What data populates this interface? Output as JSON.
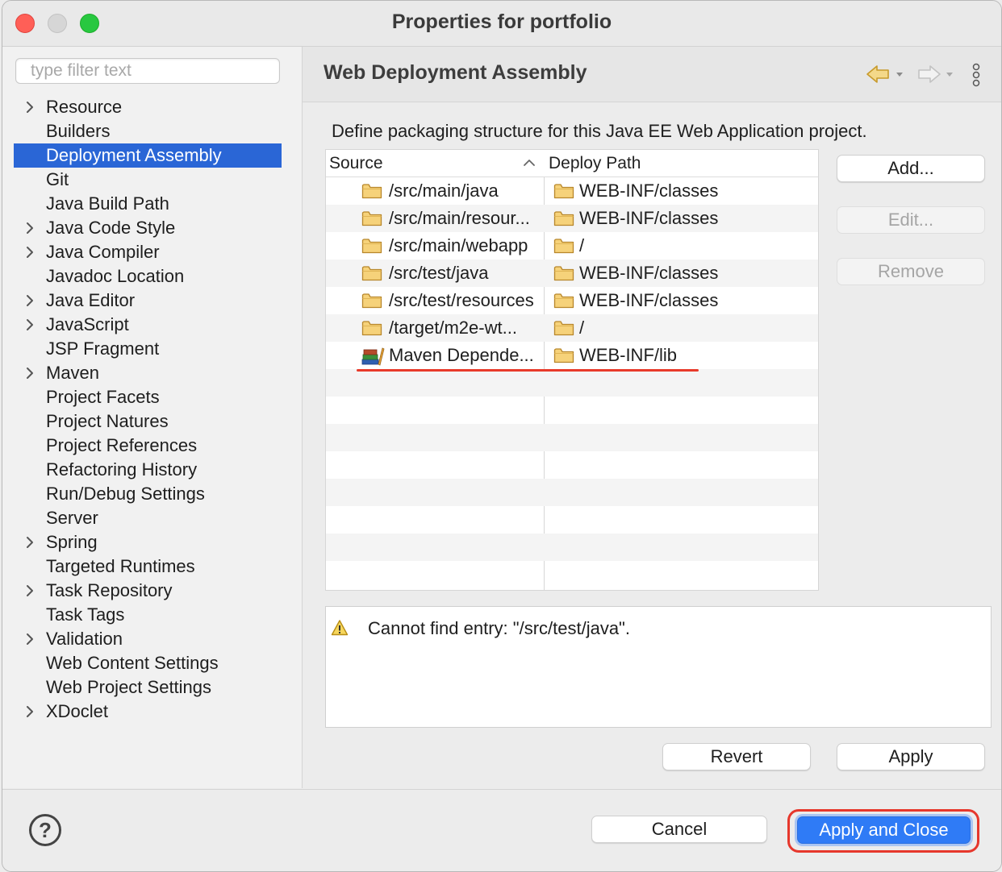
{
  "window": {
    "title": "Properties for portfolio"
  },
  "sidebar": {
    "filter_placeholder": "type filter text",
    "items": [
      {
        "label": "Resource",
        "expandable": true
      },
      {
        "label": "Builders",
        "expandable": false
      },
      {
        "label": "Deployment Assembly",
        "expandable": false,
        "selected": true
      },
      {
        "label": "Git",
        "expandable": false
      },
      {
        "label": "Java Build Path",
        "expandable": false
      },
      {
        "label": "Java Code Style",
        "expandable": true
      },
      {
        "label": "Java Compiler",
        "expandable": true
      },
      {
        "label": "Javadoc Location",
        "expandable": false
      },
      {
        "label": "Java Editor",
        "expandable": true
      },
      {
        "label": "JavaScript",
        "expandable": true
      },
      {
        "label": "JSP Fragment",
        "expandable": false
      },
      {
        "label": "Maven",
        "expandable": true
      },
      {
        "label": "Project Facets",
        "expandable": false
      },
      {
        "label": "Project Natures",
        "expandable": false
      },
      {
        "label": "Project References",
        "expandable": false
      },
      {
        "label": "Refactoring History",
        "expandable": false
      },
      {
        "label": "Run/Debug Settings",
        "expandable": false
      },
      {
        "label": "Server",
        "expandable": false
      },
      {
        "label": "Spring",
        "expandable": true
      },
      {
        "label": "Targeted Runtimes",
        "expandable": false
      },
      {
        "label": "Task Repository",
        "expandable": true
      },
      {
        "label": "Task Tags",
        "expandable": false
      },
      {
        "label": "Validation",
        "expandable": true
      },
      {
        "label": "Web Content Settings",
        "expandable": false
      },
      {
        "label": "Web Project Settings",
        "expandable": false
      },
      {
        "label": "XDoclet",
        "expandable": true
      }
    ]
  },
  "page": {
    "title": "Web Deployment Assembly",
    "description": "Define packaging structure for this Java EE Web Application project.",
    "icons": {
      "back": "back-arrow-icon",
      "forward": "forward-arrow-icon",
      "menu": "vertical-ellipsis-icon"
    },
    "table": {
      "columns": [
        "Source",
        "Deploy Path"
      ],
      "rows": [
        {
          "source": "/src/main/java",
          "deploy_path": "WEB-INF/classes",
          "icon": "folder"
        },
        {
          "source": "/src/main/resour...",
          "deploy_path": "WEB-INF/classes",
          "icon": "folder"
        },
        {
          "source": "/src/main/webapp",
          "deploy_path": "/",
          "icon": "folder"
        },
        {
          "source": "/src/test/java",
          "deploy_path": "WEB-INF/classes",
          "icon": "folder"
        },
        {
          "source": "/src/test/resources",
          "deploy_path": "WEB-INF/classes",
          "icon": "folder"
        },
        {
          "source": "/target/m2e-wt...",
          "deploy_path": "/",
          "icon": "folder"
        },
        {
          "source": "Maven Depende...",
          "deploy_path": "WEB-INF/lib",
          "icon": "library"
        }
      ]
    },
    "buttons": {
      "add": "Add...",
      "edit": "Edit...",
      "remove": "Remove",
      "revert": "Revert",
      "apply": "Apply"
    },
    "message": {
      "icon": "warning-icon",
      "text": "Cannot find entry: \"/src/test/java\"."
    }
  },
  "footer": {
    "help_symbol": "?",
    "cancel": "Cancel",
    "apply_close": "Apply and Close"
  },
  "colors": {
    "selection": "#2a66d6",
    "primary_button": "#2f7bf6",
    "annotation_red": "#e6372c"
  }
}
